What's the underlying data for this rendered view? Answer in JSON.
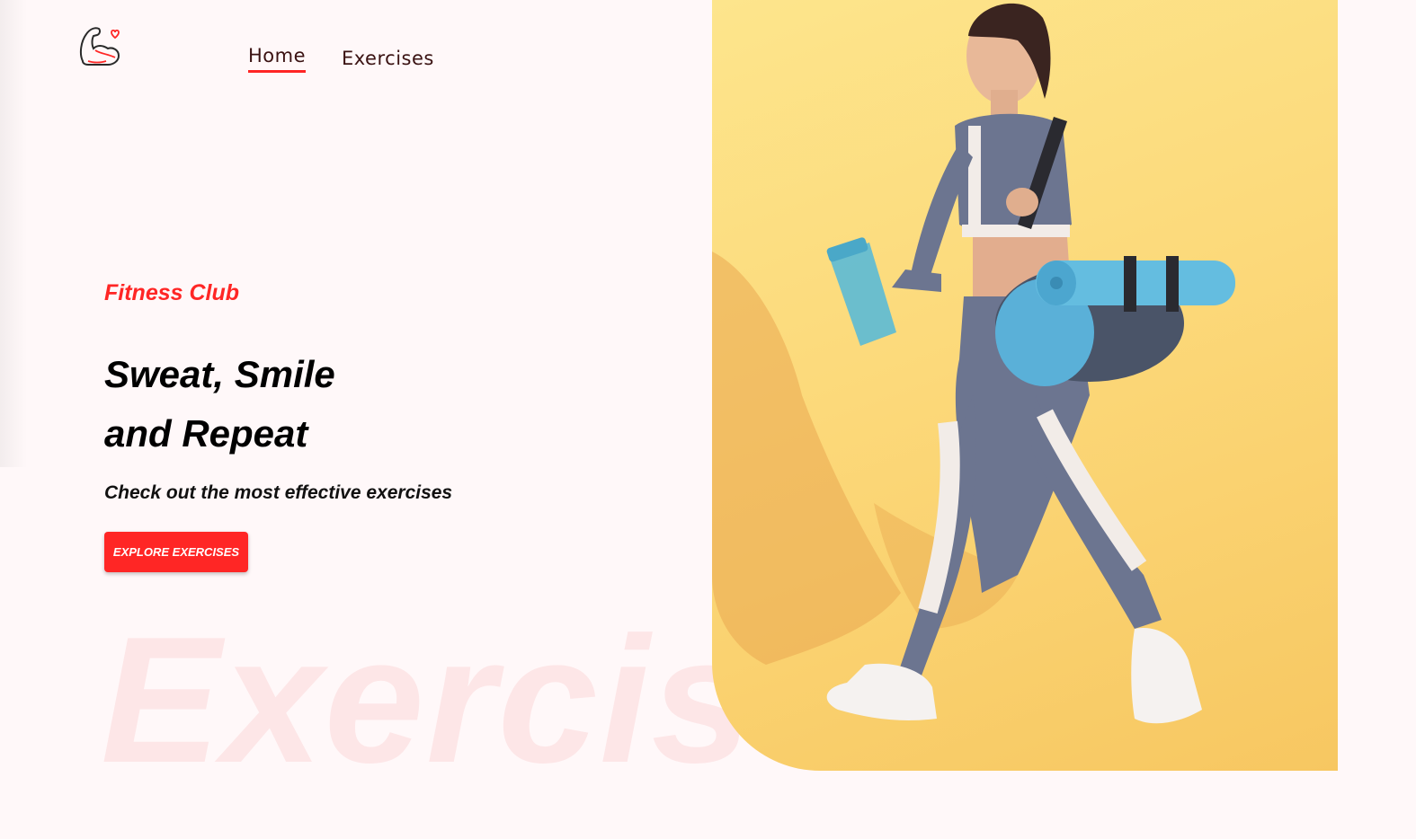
{
  "nav": {
    "logo": "gym-logo-icon",
    "items": [
      {
        "label": "Home",
        "active": true
      },
      {
        "label": "Exercises",
        "active": false
      }
    ]
  },
  "hero": {
    "eyebrow": "Fitness Club",
    "headline_line1": "Sweat, Smile",
    "headline_line2": "and Repeat",
    "subtext": "Check out the most effective exercises",
    "cta_label": "EXPLORE EXERCISES",
    "watermark": "Exercise",
    "image": "woman-walking-with-gym-bag-and-shaker-photo"
  },
  "colors": {
    "accent": "#ff2625",
    "background": "#fff8f9",
    "watermark": "#fde6e7",
    "image_background": "#fcd97a"
  }
}
